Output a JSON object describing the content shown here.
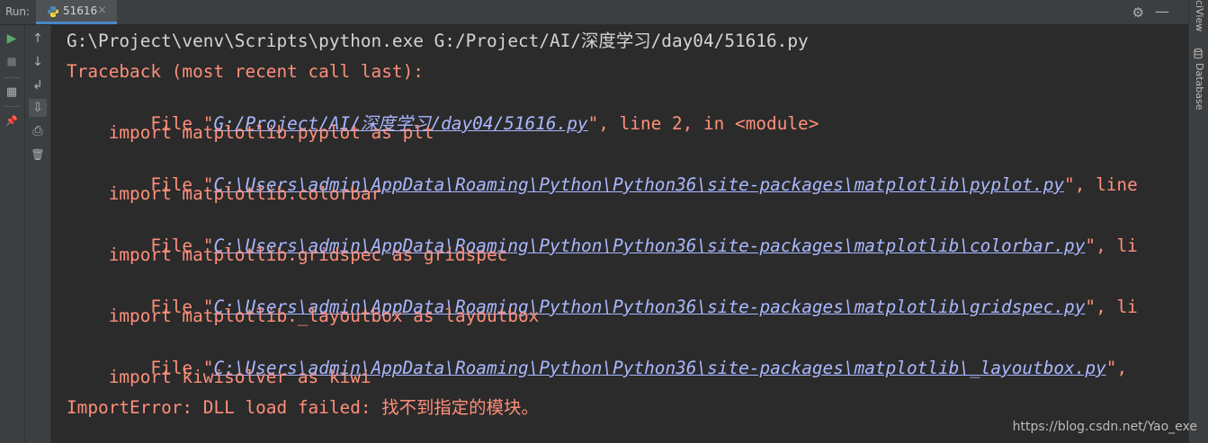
{
  "run_bar": {
    "label": "Run:",
    "tab": "51616",
    "close_glyph": "×"
  },
  "icons": {
    "gear": "⚙",
    "minimize": "—",
    "rerun": "▶",
    "stop": "■",
    "layout": "▦",
    "pin": "📌",
    "up": "↑",
    "down": "↓",
    "softwrap": "↲",
    "scroll_end": "⇩",
    "print": "⎙",
    "trash": "🗑"
  },
  "right_strip": {
    "sciview": "ciView",
    "database": "Database"
  },
  "console": {
    "cmd": "G:\\Project\\venv\\Scripts\\python.exe G:/Project/AI/深度学习/day04/51616.py",
    "traceback": "Traceback (most recent call last):",
    "frames": [
      {
        "prefix": "  File \"",
        "path": "G:/Project/AI/深度学习/day04/51616.py",
        "suffix": "\", line 2, in <module>",
        "code": "    import matplotlib.pyplot as plt"
      },
      {
        "prefix": "  File \"",
        "path": "C:\\Users\\admin\\AppData\\Roaming\\Python\\Python36\\site-packages\\matplotlib\\pyplot.py",
        "suffix": "\", line",
        "code": "    import matplotlib.colorbar"
      },
      {
        "prefix": "  File \"",
        "path": "C:\\Users\\admin\\AppData\\Roaming\\Python\\Python36\\site-packages\\matplotlib\\colorbar.py",
        "suffix": "\", li",
        "code": "    import matplotlib.gridspec as gridspec"
      },
      {
        "prefix": "  File \"",
        "path": "C:\\Users\\admin\\AppData\\Roaming\\Python\\Python36\\site-packages\\matplotlib\\gridspec.py",
        "suffix": "\", li",
        "code": "    import matplotlib._layoutbox as layoutbox"
      },
      {
        "prefix": "  File \"",
        "path": "C:\\Users\\admin\\AppData\\Roaming\\Python\\Python36\\site-packages\\matplotlib\\_layoutbox.py",
        "suffix": "\",",
        "code": "    import kiwisolver as kiwi"
      }
    ],
    "error": "ImportError: DLL load failed: 找不到指定的模块。"
  },
  "watermark": "https://blog.csdn.net/Yao_exe",
  "colors": {
    "background": "#2b2b2b",
    "error_text": "#ff8f7a",
    "link_text": "#a9b7ff",
    "command_text": "#d4d4d4",
    "accent": "#4a88c7",
    "run_green": "#59a869"
  }
}
